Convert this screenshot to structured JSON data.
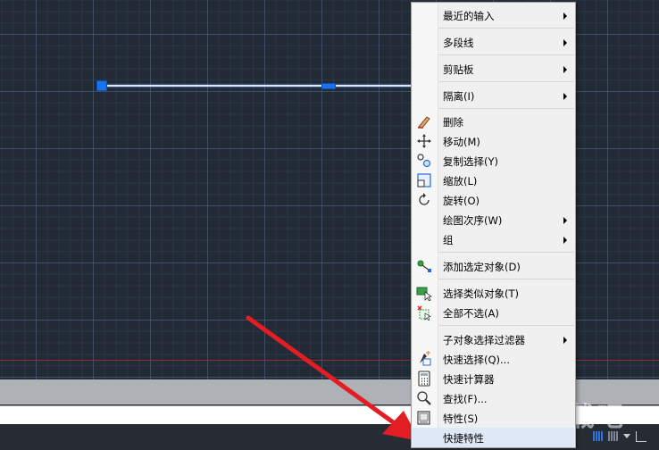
{
  "context_menu": {
    "items": [
      {
        "label": "最近的输入"
      },
      {
        "label": "多段线"
      },
      {
        "label": "剪贴板"
      },
      {
        "label": "隔离(I)"
      },
      {
        "label": "删除"
      },
      {
        "label": "移动(M)"
      },
      {
        "label": "复制选择(Y)"
      },
      {
        "label": "缩放(L)"
      },
      {
        "label": "旋转(O)"
      },
      {
        "label": "绘图次序(W)"
      },
      {
        "label": "组"
      },
      {
        "label": "添加选定对象(D)"
      },
      {
        "label": "选择类似对象(T)"
      },
      {
        "label": "全部不选(A)"
      },
      {
        "label": "子对象选择过滤器"
      },
      {
        "label": "快速选择(Q)..."
      },
      {
        "label": "快速计算器"
      },
      {
        "label": "查找(F)..."
      },
      {
        "label": "特性(S)"
      },
      {
        "label": "快捷特性"
      }
    ],
    "icons": [
      "eraser-icon",
      "move-icon",
      "copy-selection-icon",
      "scale-icon",
      "rotate-icon",
      "add-selected-icon",
      "select-similar-icon",
      "deselect-all-icon",
      "quick-select-icon",
      "calculator-icon",
      "find-icon",
      "properties-icon"
    ]
  },
  "watermark": {
    "text": "下载吧"
  },
  "colors": {
    "accent_arrow": "#e21d23",
    "grip": "#1a73e8",
    "canvas_bg": "#222a36",
    "menu_bg": "#f0f0f0"
  }
}
